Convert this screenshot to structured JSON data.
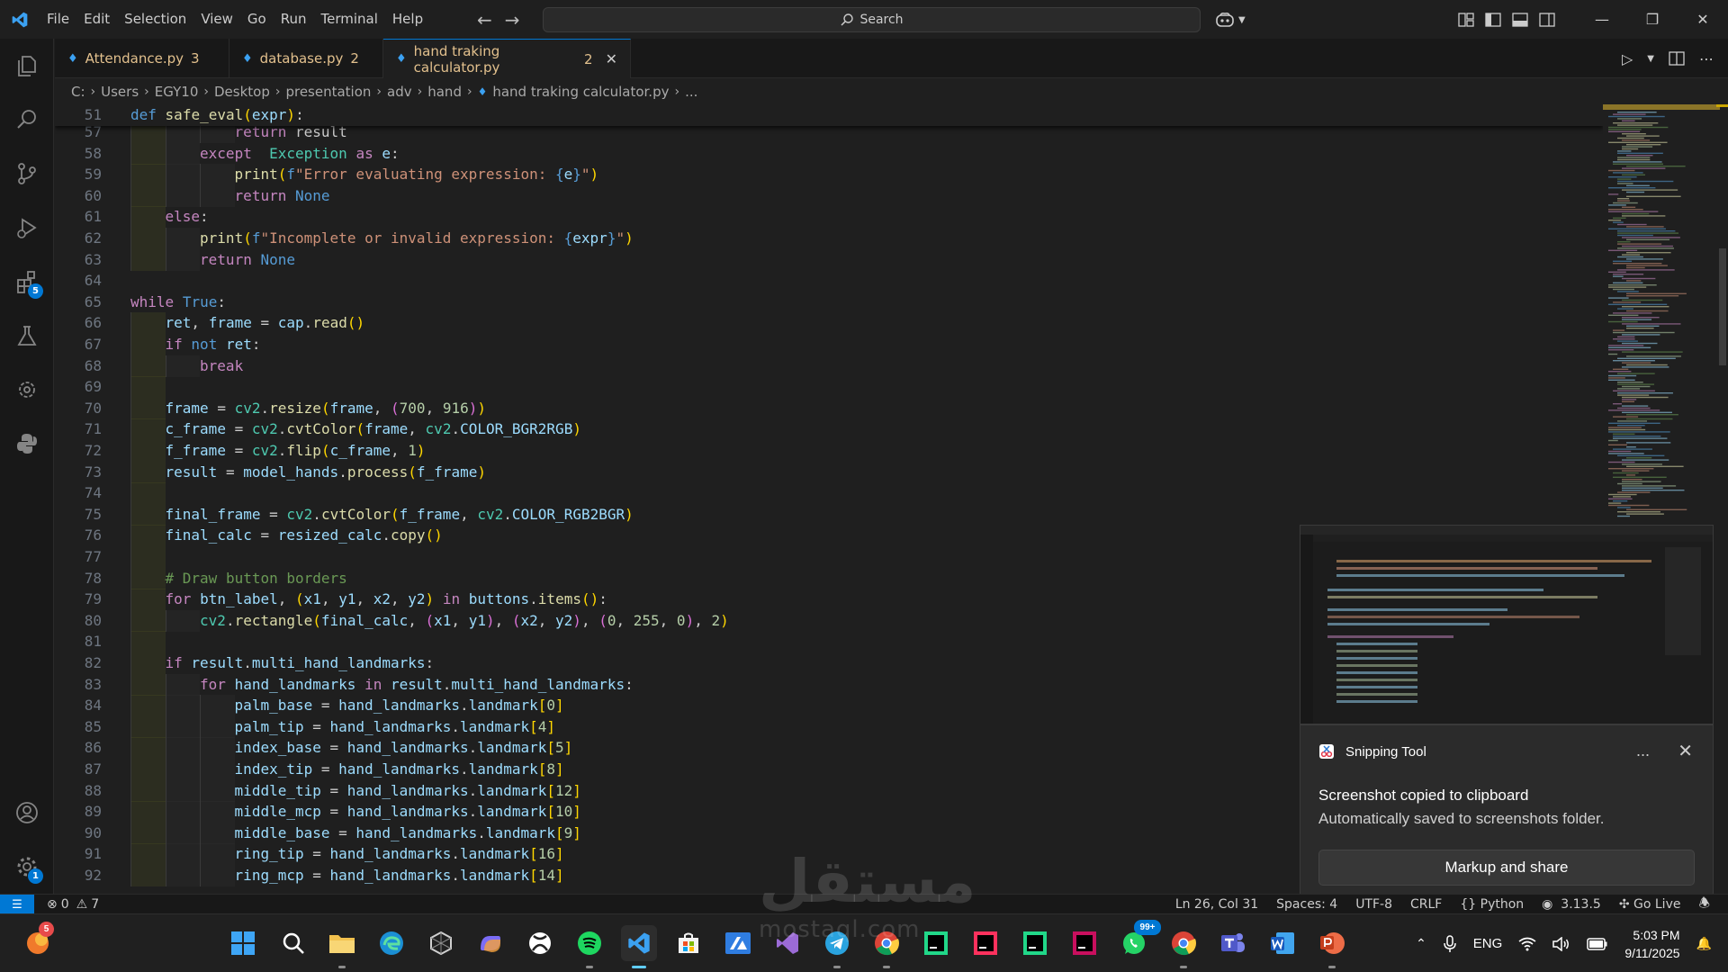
{
  "menu": [
    "File",
    "Edit",
    "Selection",
    "View",
    "Go",
    "Run",
    "Terminal",
    "Help"
  ],
  "search": {
    "placeholder": "Search"
  },
  "tabs": [
    {
      "label": "Attendance.py",
      "count": "3",
      "active": false
    },
    {
      "label": "database.py",
      "count": "2",
      "active": false
    },
    {
      "label": "hand traking calculator.py",
      "count": "2",
      "active": true
    }
  ],
  "breadcrumbs": [
    "C:",
    "Users",
    "EGY10",
    "Desktop",
    "presentation",
    "adv",
    "hand",
    "hand traking calculator.py",
    "..."
  ],
  "activity_badges": {
    "extensions": "5",
    "accounts": "1"
  },
  "sticky": {
    "ln": "51",
    "code": "def safe_eval(expr):"
  },
  "code": [
    {
      "ln": "57",
      "indent": 3,
      "tokens": [
        [
          "ctl",
          "return"
        ],
        [
          "",
          "result"
        ]
      ]
    },
    {
      "ln": "58",
      "indent": 2,
      "tokens": [
        [
          "ctl",
          "except"
        ],
        [
          "",
          ""
        ],
        [
          "cls",
          "Exception"
        ],
        [
          "",
          ""
        ],
        [
          "ctl",
          "as"
        ],
        [
          "var",
          "e"
        ],
        [
          "",
          ":"
        ]
      ]
    },
    {
      "ln": "59",
      "indent": 3,
      "tokens": [
        [
          "fn",
          "print"
        ],
        [
          "brk1",
          "("
        ],
        [
          "kw",
          "f"
        ],
        [
          "str",
          "\"Error evaluating expression: "
        ],
        [
          "kw",
          "{"
        ],
        [
          "var",
          "e"
        ],
        [
          "kw",
          "}"
        ],
        [
          "str",
          "\""
        ],
        [
          "brk1",
          ")"
        ]
      ]
    },
    {
      "ln": "60",
      "indent": 3,
      "tokens": [
        [
          "ctl",
          "return"
        ],
        [
          "kw",
          "None"
        ]
      ]
    },
    {
      "ln": "61",
      "indent": 1,
      "tokens": [
        [
          "ctl",
          "else"
        ],
        [
          "",
          ":"
        ]
      ]
    },
    {
      "ln": "62",
      "indent": 2,
      "tokens": [
        [
          "fn",
          "print"
        ],
        [
          "brk1",
          "("
        ],
        [
          "kw",
          "f"
        ],
        [
          "str",
          "\"Incomplete or invalid expression: "
        ],
        [
          "kw",
          "{"
        ],
        [
          "var",
          "expr"
        ],
        [
          "kw",
          "}"
        ],
        [
          "str",
          "\""
        ],
        [
          "brk1",
          ")"
        ]
      ]
    },
    {
      "ln": "63",
      "indent": 2,
      "tokens": [
        [
          "ctl",
          "return"
        ],
        [
          "kw",
          "None"
        ]
      ]
    },
    {
      "ln": "64",
      "indent": 0,
      "tokens": []
    },
    {
      "ln": "65",
      "indent": 0,
      "tokens": [
        [
          "ctl",
          "while"
        ],
        [
          "kw",
          "True"
        ],
        [
          "",
          ":"
        ]
      ]
    },
    {
      "ln": "66",
      "indent": 1,
      "tokens": [
        [
          "var",
          "ret"
        ],
        [
          "",
          ", "
        ],
        [
          "var",
          "frame"
        ],
        [
          "",
          " = "
        ],
        [
          "var",
          "cap"
        ],
        [
          "",
          "."
        ],
        [
          "fn",
          "read"
        ],
        [
          "brk1",
          "()"
        ]
      ]
    },
    {
      "ln": "67",
      "indent": 1,
      "tokens": [
        [
          "ctl",
          "if"
        ],
        [
          "kw",
          "not"
        ],
        [
          "var",
          "ret"
        ],
        [
          "",
          ":"
        ]
      ]
    },
    {
      "ln": "68",
      "indent": 2,
      "tokens": [
        [
          "ctl",
          "break"
        ]
      ]
    },
    {
      "ln": "69",
      "indent": 0,
      "tokens": []
    },
    {
      "ln": "70",
      "indent": 1,
      "tokens": [
        [
          "var",
          "frame"
        ],
        [
          "",
          " = "
        ],
        [
          "cls",
          "cv2"
        ],
        [
          "",
          "."
        ],
        [
          "fn",
          "resize"
        ],
        [
          "brk1",
          "("
        ],
        [
          "var",
          "frame"
        ],
        [
          "",
          ", "
        ],
        [
          "brk2",
          "("
        ],
        [
          "num",
          "700"
        ],
        [
          "",
          ", "
        ],
        [
          "num",
          "916"
        ],
        [
          "brk2",
          ")"
        ],
        [
          "brk1",
          ")"
        ]
      ]
    },
    {
      "ln": "71",
      "indent": 1,
      "tokens": [
        [
          "var",
          "c_frame"
        ],
        [
          "",
          " = "
        ],
        [
          "cls",
          "cv2"
        ],
        [
          "",
          "."
        ],
        [
          "fn",
          "cvtColor"
        ],
        [
          "brk1",
          "("
        ],
        [
          "var",
          "frame"
        ],
        [
          "",
          ", "
        ],
        [
          "cls",
          "cv2"
        ],
        [
          "",
          "."
        ],
        [
          "var",
          "COLOR_BGR2RGB"
        ],
        [
          "brk1",
          ")"
        ]
      ]
    },
    {
      "ln": "72",
      "indent": 1,
      "tokens": [
        [
          "var",
          "f_frame"
        ],
        [
          "",
          " = "
        ],
        [
          "cls",
          "cv2"
        ],
        [
          "",
          "."
        ],
        [
          "fn",
          "flip"
        ],
        [
          "brk1",
          "("
        ],
        [
          "var",
          "c_frame"
        ],
        [
          "",
          ", "
        ],
        [
          "num",
          "1"
        ],
        [
          "brk1",
          ")"
        ]
      ]
    },
    {
      "ln": "73",
      "indent": 1,
      "tokens": [
        [
          "var",
          "result"
        ],
        [
          "",
          " = "
        ],
        [
          "var",
          "model_hands"
        ],
        [
          "",
          "."
        ],
        [
          "fn",
          "process"
        ],
        [
          "brk1",
          "("
        ],
        [
          "var",
          "f_frame"
        ],
        [
          "brk1",
          ")"
        ]
      ]
    },
    {
      "ln": "74",
      "indent": 0,
      "tokens": []
    },
    {
      "ln": "75",
      "indent": 1,
      "tokens": [
        [
          "var",
          "final_frame"
        ],
        [
          "",
          " = "
        ],
        [
          "cls",
          "cv2"
        ],
        [
          "",
          "."
        ],
        [
          "fn",
          "cvtColor"
        ],
        [
          "brk1",
          "("
        ],
        [
          "var",
          "f_frame"
        ],
        [
          "",
          ", "
        ],
        [
          "cls",
          "cv2"
        ],
        [
          "",
          "."
        ],
        [
          "var",
          "COLOR_RGB2BGR"
        ],
        [
          "brk1",
          ")"
        ]
      ]
    },
    {
      "ln": "76",
      "indent": 1,
      "tokens": [
        [
          "var",
          "final_calc"
        ],
        [
          "",
          " = "
        ],
        [
          "var",
          "resized_calc"
        ],
        [
          "",
          "."
        ],
        [
          "fn",
          "copy"
        ],
        [
          "brk1",
          "()"
        ]
      ]
    },
    {
      "ln": "77",
      "indent": 0,
      "tokens": []
    },
    {
      "ln": "78",
      "indent": 1,
      "tokens": [
        [
          "cmt",
          "# Draw button borders"
        ]
      ]
    },
    {
      "ln": "79",
      "indent": 1,
      "tokens": [
        [
          "ctl",
          "for"
        ],
        [
          "var",
          "btn_label"
        ],
        [
          "",
          ", "
        ],
        [
          "brk1",
          "("
        ],
        [
          "var",
          "x1"
        ],
        [
          "",
          ", "
        ],
        [
          "var",
          "y1"
        ],
        [
          "",
          ", "
        ],
        [
          "var",
          "x2"
        ],
        [
          "",
          ", "
        ],
        [
          "var",
          "y2"
        ],
        [
          "brk1",
          ")"
        ],
        [
          "",
          ""
        ],
        [
          "ctl",
          "in"
        ],
        [
          "var",
          "buttons"
        ],
        [
          "",
          "."
        ],
        [
          "fn",
          "items"
        ],
        [
          "brk1",
          "()"
        ],
        [
          "",
          ":"
        ]
      ]
    },
    {
      "ln": "80",
      "indent": 2,
      "tokens": [
        [
          "cls",
          "cv2"
        ],
        [
          "",
          "."
        ],
        [
          "fn",
          "rectangle"
        ],
        [
          "brk1",
          "("
        ],
        [
          "var",
          "final_calc"
        ],
        [
          "",
          ", "
        ],
        [
          "brk2",
          "("
        ],
        [
          "var",
          "x1"
        ],
        [
          "",
          ", "
        ],
        [
          "var",
          "y1"
        ],
        [
          "brk2",
          ")"
        ],
        [
          "",
          ", "
        ],
        [
          "brk2",
          "("
        ],
        [
          "var",
          "x2"
        ],
        [
          "",
          ", "
        ],
        [
          "var",
          "y2"
        ],
        [
          "brk2",
          ")"
        ],
        [
          "",
          ", "
        ],
        [
          "brk2",
          "("
        ],
        [
          "num",
          "0"
        ],
        [
          "",
          ", "
        ],
        [
          "num",
          "255"
        ],
        [
          "",
          ", "
        ],
        [
          "num",
          "0"
        ],
        [
          "brk2",
          ")"
        ],
        [
          "",
          ", "
        ],
        [
          "num",
          "2"
        ],
        [
          "brk1",
          ")"
        ]
      ]
    },
    {
      "ln": "81",
      "indent": 0,
      "tokens": []
    },
    {
      "ln": "82",
      "indent": 1,
      "tokens": [
        [
          "ctl",
          "if"
        ],
        [
          "var",
          "result"
        ],
        [
          "",
          "."
        ],
        [
          "var",
          "multi_hand_landmarks"
        ],
        [
          "",
          ":"
        ]
      ]
    },
    {
      "ln": "83",
      "indent": 2,
      "tokens": [
        [
          "ctl",
          "for"
        ],
        [
          "var",
          "hand_landmarks"
        ],
        [
          "",
          ""
        ],
        [
          "ctl",
          "in"
        ],
        [
          "var",
          "result"
        ],
        [
          "",
          "."
        ],
        [
          "var",
          "multi_hand_landmarks"
        ],
        [
          "",
          ":"
        ]
      ]
    },
    {
      "ln": "84",
      "indent": 3,
      "tokens": [
        [
          "var",
          "palm_base"
        ],
        [
          "",
          " = "
        ],
        [
          "var",
          "hand_landmarks"
        ],
        [
          "",
          "."
        ],
        [
          "var",
          "landmark"
        ],
        [
          "brk1",
          "["
        ],
        [
          "num",
          "0"
        ],
        [
          "brk1",
          "]"
        ]
      ]
    },
    {
      "ln": "85",
      "indent": 3,
      "tokens": [
        [
          "var",
          "palm_tip"
        ],
        [
          "",
          " = "
        ],
        [
          "var",
          "hand_landmarks"
        ],
        [
          "",
          "."
        ],
        [
          "var",
          "landmark"
        ],
        [
          "brk1",
          "["
        ],
        [
          "num",
          "4"
        ],
        [
          "brk1",
          "]"
        ]
      ]
    },
    {
      "ln": "86",
      "indent": 3,
      "tokens": [
        [
          "var",
          "index_base"
        ],
        [
          "",
          " = "
        ],
        [
          "var",
          "hand_landmarks"
        ],
        [
          "",
          "."
        ],
        [
          "var",
          "landmark"
        ],
        [
          "brk1",
          "["
        ],
        [
          "num",
          "5"
        ],
        [
          "brk1",
          "]"
        ]
      ]
    },
    {
      "ln": "87",
      "indent": 3,
      "tokens": [
        [
          "var",
          "index_tip"
        ],
        [
          "",
          " = "
        ],
        [
          "var",
          "hand_landmarks"
        ],
        [
          "",
          "."
        ],
        [
          "var",
          "landmark"
        ],
        [
          "brk1",
          "["
        ],
        [
          "num",
          "8"
        ],
        [
          "brk1",
          "]"
        ]
      ]
    },
    {
      "ln": "88",
      "indent": 3,
      "tokens": [
        [
          "var",
          "middle_tip"
        ],
        [
          "",
          " = "
        ],
        [
          "var",
          "hand_landmarks"
        ],
        [
          "",
          "."
        ],
        [
          "var",
          "landmark"
        ],
        [
          "brk1",
          "["
        ],
        [
          "num",
          "12"
        ],
        [
          "brk1",
          "]"
        ]
      ]
    },
    {
      "ln": "89",
      "indent": 3,
      "tokens": [
        [
          "var",
          "middle_mcp"
        ],
        [
          "",
          " = "
        ],
        [
          "var",
          "hand_landmarks"
        ],
        [
          "",
          "."
        ],
        [
          "var",
          "landmark"
        ],
        [
          "brk1",
          "["
        ],
        [
          "num",
          "10"
        ],
        [
          "brk1",
          "]"
        ]
      ]
    },
    {
      "ln": "90",
      "indent": 3,
      "tokens": [
        [
          "var",
          "middle_base"
        ],
        [
          "",
          " = "
        ],
        [
          "var",
          "hand_landmarks"
        ],
        [
          "",
          "."
        ],
        [
          "var",
          "landmark"
        ],
        [
          "brk1",
          "["
        ],
        [
          "num",
          "9"
        ],
        [
          "brk1",
          "]"
        ]
      ]
    },
    {
      "ln": "91",
      "indent": 3,
      "tokens": [
        [
          "var",
          "ring_tip"
        ],
        [
          "",
          " = "
        ],
        [
          "var",
          "hand_landmarks"
        ],
        [
          "",
          "."
        ],
        [
          "var",
          "landmark"
        ],
        [
          "brk1",
          "["
        ],
        [
          "num",
          "16"
        ],
        [
          "brk1",
          "]"
        ]
      ]
    },
    {
      "ln": "92",
      "indent": 3,
      "tokens": [
        [
          "var",
          "ring_mcp"
        ],
        [
          "",
          " = "
        ],
        [
          "var",
          "hand_landmarks"
        ],
        [
          "",
          "."
        ],
        [
          "var",
          "landmark"
        ],
        [
          "brk1",
          "["
        ],
        [
          "num",
          "14"
        ],
        [
          "brk1",
          "]"
        ]
      ]
    }
  ],
  "snipping": {
    "app_name": "Snipping Tool",
    "more": "...",
    "title": "Screenshot copied to clipboard",
    "body": "Automatically saved to screenshots folder.",
    "action": "Markup and share"
  },
  "statusbar": {
    "errors": "0",
    "warnings": "7",
    "position": "Ln 26, Col 31",
    "spaces": "Spaces: 4",
    "encoding": "UTF-8",
    "eol": "CRLF",
    "language": "Python",
    "python_version": "3.13.5",
    "golive": "Go Live"
  },
  "taskbar": {
    "notification_count": "5",
    "whatsapp_badge": "99+",
    "language": "ENG",
    "time": "5:03 PM",
    "date": "9/11/2025"
  },
  "watermark": {
    "arabic": "مستقل",
    "latin": "mostaql.com"
  },
  "colors": {
    "accent": "#0078d4",
    "editor_bg": "#1f1f1f",
    "warning_tab": "#e2c08d"
  }
}
